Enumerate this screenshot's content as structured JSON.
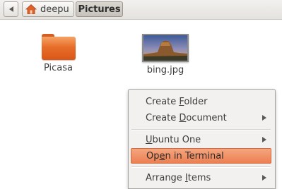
{
  "pathbar": {
    "crumbs": [
      "deepu",
      "Pictures"
    ]
  },
  "files": [
    {
      "name": "Picasa",
      "icon": "folder-icon"
    },
    {
      "name": "bing.jpg",
      "icon": "image-thumbnail"
    }
  ],
  "context_menu": {
    "items": [
      {
        "label": "Create Folder",
        "accelerator": "F",
        "submenu": false
      },
      {
        "label": "Create Document",
        "accelerator": "D",
        "submenu": true
      },
      {
        "label": "Ubuntu One",
        "accelerator": "U",
        "submenu": true
      },
      {
        "label": "Open in Terminal",
        "accelerator": "e",
        "submenu": false,
        "highlighted": true
      },
      {
        "label": "Arrange Items",
        "accelerator": "I",
        "submenu": true
      }
    ]
  },
  "colors": {
    "folder_orange": "#e76d29",
    "menu_highlight": "#ec8053"
  }
}
